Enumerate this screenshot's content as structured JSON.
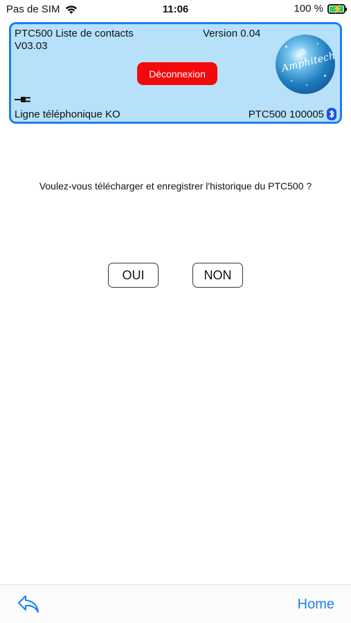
{
  "status_bar": {
    "carrier": "Pas de SIM",
    "time": "11:06",
    "battery": "100 %",
    "battery_level": 1.0,
    "wifi_icon": "wifi-icon",
    "battery_icon": "battery-charging-icon"
  },
  "panel": {
    "title": "PTC500 Liste de contacts",
    "version": "Version 0.04",
    "firmware": "V03.03",
    "disconnect_label": "Déconnexion",
    "logo_text": "Amphitech",
    "line_status": "Ligne téléphonique KO",
    "device_id": "PTC500 100005",
    "plug_icon": "plug-icon",
    "bluetooth_icon": "bluetooth-icon",
    "colors": {
      "background": "#b7e1fb",
      "border": "#1c7ef2",
      "disconnect": "#f20a0a"
    }
  },
  "dialog": {
    "question": "Voulez-vous télécharger et enregistrer l'historique du PTC500 ?",
    "yes_label": "OUI",
    "no_label": "NON"
  },
  "toolbar": {
    "back_icon": "back-arrow-icon",
    "home_label": "Home",
    "accent": "#1c7ef2"
  }
}
